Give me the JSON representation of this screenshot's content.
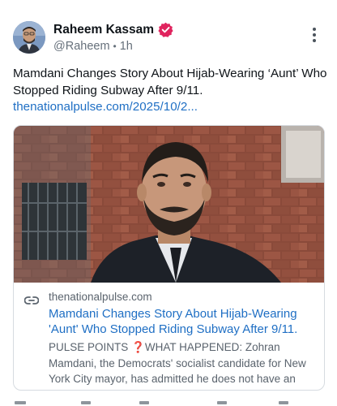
{
  "author": {
    "display_name": "Raheem Kassam",
    "handle": "@Raheem",
    "time_ago": "1h",
    "separator": "•"
  },
  "post": {
    "text": "Mamdani Changes Story About Hijab-Wearing ‘Aunt’ Who Stopped Riding Subway After 9/11.",
    "link_text": "thenationalpulse.com/2025/10/2..."
  },
  "link_card": {
    "domain": "thenationalpulse.com",
    "title": "Mamdani Changes Story About Hijab-Wearing 'Aunt' Who Stopped Riding Subway After 9/11.",
    "description": "PULSE POINTS ❓WHAT HAPPENED: Zohran Mamdani, the Democrats' socialist candidate for New York City mayor, has admitted he does not have an \"aunt\" who"
  },
  "colors": {
    "verified_badge": "#e0245e",
    "link": "#1f6fc4",
    "muted_text": "#66707b"
  },
  "icons": {
    "verified": "verified-badge-icon",
    "more": "more-vertical-icon",
    "link": "link-icon"
  }
}
